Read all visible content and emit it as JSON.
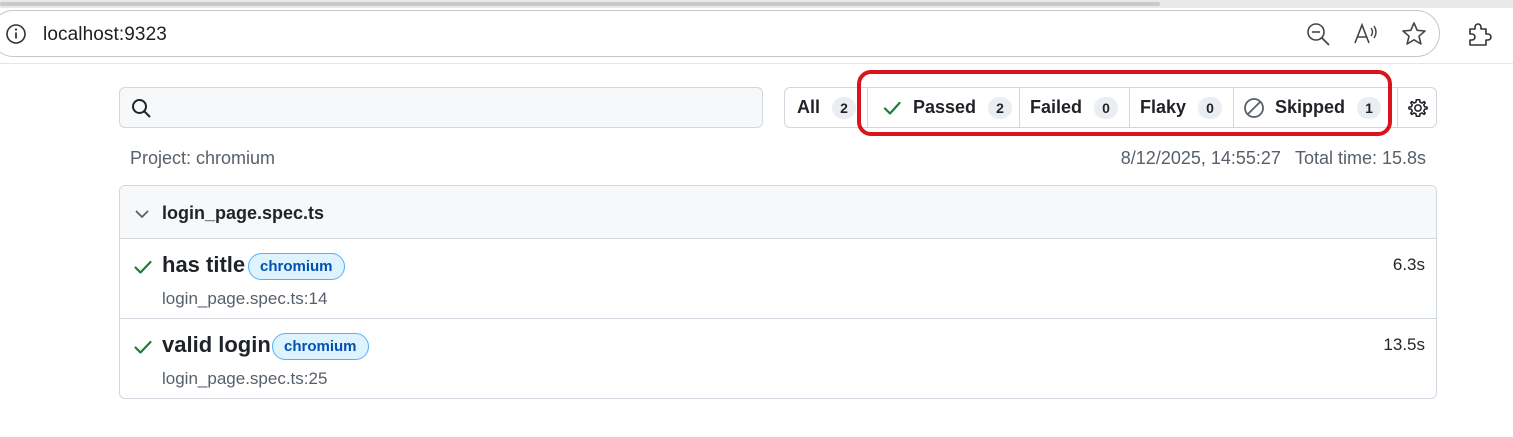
{
  "browser": {
    "url": "localhost:9323",
    "icons": [
      "info-icon",
      "zoom-out-icon",
      "read-aloud-icon",
      "favorite-star-icon",
      "extensions-icon"
    ]
  },
  "search": {
    "placeholder": ""
  },
  "filters": {
    "all": {
      "label": "All",
      "count": "2"
    },
    "passed": {
      "label": "Passed",
      "count": "2",
      "icon": "check-icon"
    },
    "failed": {
      "label": "Failed",
      "count": "0"
    },
    "flaky": {
      "label": "Flaky",
      "count": "0"
    },
    "skipped": {
      "label": "Skipped",
      "count": "1",
      "icon": "skipped-circle-icon"
    },
    "settings_icon": "gear-icon"
  },
  "meta": {
    "project": "Project: chromium",
    "timestamp": "8/12/2025, 14:55:27",
    "total_time": "Total time: 15.8s"
  },
  "file": {
    "name": "login_page.spec.ts",
    "tests": [
      {
        "title": "has title",
        "tag": "chromium",
        "location": "login_page.spec.ts:14",
        "duration": "6.3s",
        "status": "passed"
      },
      {
        "title": "valid login",
        "tag": "chromium",
        "location": "login_page.spec.ts:25",
        "duration": "13.5s",
        "status": "passed"
      }
    ]
  },
  "colors": {
    "pass_green": "#1a7f37",
    "highlight_red": "#d9141c",
    "tag_bg": "#ddf4ff",
    "tag_border": "#54aeff",
    "tag_text": "#0550ae"
  }
}
